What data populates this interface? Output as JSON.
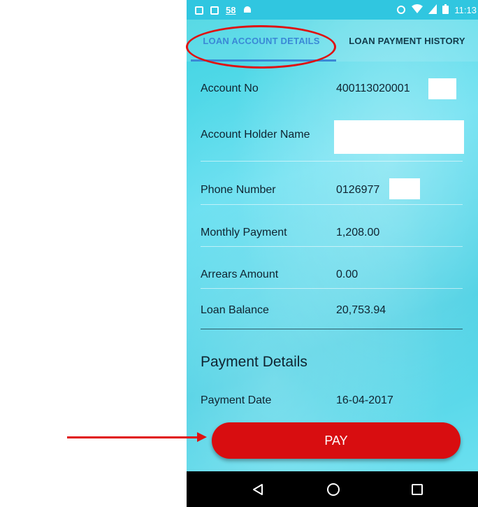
{
  "status_bar": {
    "notification_count": "58",
    "time": "11:13"
  },
  "tabs": [
    {
      "label": "LOAN ACCOUNT DETAILS",
      "active": true
    },
    {
      "label": "LOAN PAYMENT HISTORY",
      "active": false
    }
  ],
  "account": {
    "account_no_label": "Account No",
    "account_no_value": "400113020001",
    "holder_name_label": "Account Holder Name",
    "phone_label": "Phone Number",
    "phone_value": "0126977",
    "monthly_payment_label": "Monthly Payment",
    "monthly_payment_value": "1,208.00",
    "arrears_label": "Arrears Amount",
    "arrears_value": "0.00",
    "loan_balance_label": "Loan Balance",
    "loan_balance_value": "20,753.94"
  },
  "payment": {
    "section_title": "Payment Details",
    "date_label": "Payment Date",
    "date_value": "16-04-2017",
    "pay_button_label": "PAY"
  },
  "colors": {
    "accent_blue": "#3a88d6",
    "pay_red": "#d80d10",
    "annotation_red": "#e01010"
  },
  "nav_icons": [
    "back-icon",
    "home-icon",
    "recents-icon"
  ]
}
